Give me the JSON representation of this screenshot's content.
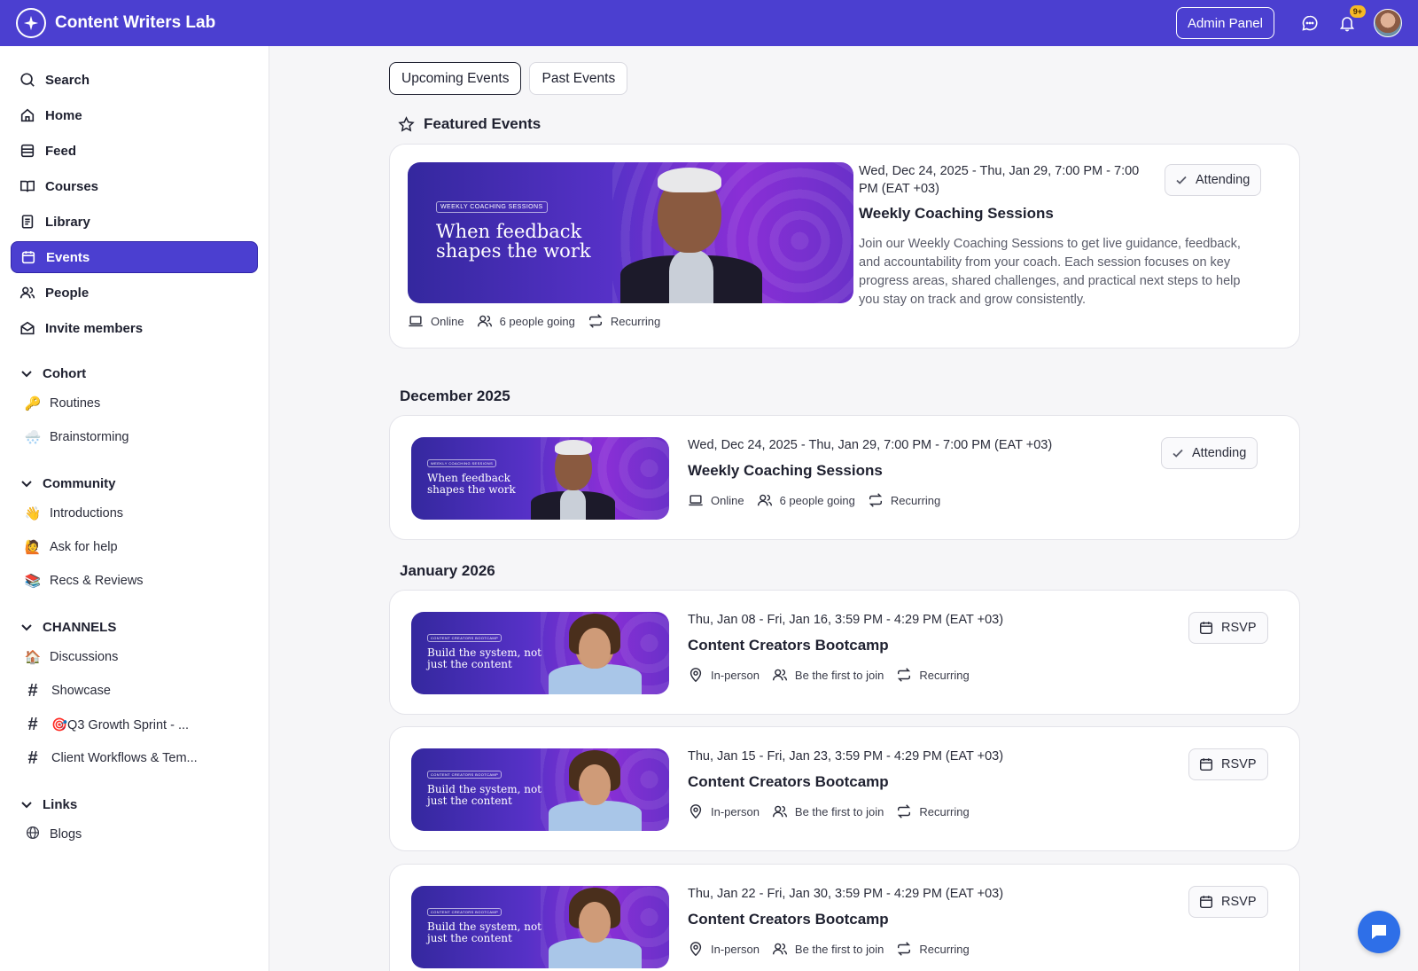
{
  "app": {
    "title": "Content Writers Lab"
  },
  "topbar": {
    "admin_label": "Admin Panel",
    "notif_badge": "9+"
  },
  "sidebar": {
    "nav": [
      {
        "label": "Search",
        "icon": "search-icon"
      },
      {
        "label": "Home",
        "icon": "home-icon"
      },
      {
        "label": "Feed",
        "icon": "feed-icon"
      },
      {
        "label": "Courses",
        "icon": "book-icon"
      },
      {
        "label": "Library",
        "icon": "library-icon"
      },
      {
        "label": "Events",
        "icon": "calendar-icon",
        "active": true
      },
      {
        "label": "People",
        "icon": "people-icon"
      },
      {
        "label": "Invite members",
        "icon": "envelope-icon"
      }
    ],
    "sections": {
      "cohort": {
        "label": "Cohort",
        "items": [
          {
            "emoji": "🔑",
            "label": "Routines"
          },
          {
            "emoji": "🌨️",
            "label": "Brainstorming"
          }
        ]
      },
      "community": {
        "label": "Community",
        "items": [
          {
            "emoji": "👋",
            "label": "Introductions"
          },
          {
            "emoji": "🙋",
            "label": "Ask for help"
          },
          {
            "emoji": "📚",
            "label": "Recs & Reviews"
          }
        ]
      },
      "channels": {
        "label": "CHANNELS",
        "items": [
          {
            "emoji": "🏠",
            "label": "Discussions"
          },
          {
            "emoji": "#",
            "label": "Showcase"
          },
          {
            "emoji": "#",
            "label": "🎯Q3 Growth Sprint - ..."
          },
          {
            "emoji": "#",
            "label": "Client Workflows & Tem..."
          }
        ]
      },
      "links": {
        "label": "Links",
        "items": [
          {
            "emoji": "globe",
            "label": "Blogs"
          }
        ]
      }
    }
  },
  "tabs": {
    "upcoming": "Upcoming Events",
    "past": "Past Events"
  },
  "featured": {
    "heading": "Featured Events",
    "date": "Wed, Dec 24, 2025 - Thu, Jan 29, 7:00 PM - 7:00 PM (EAT +03)",
    "title": "Weekly Coaching Sessions",
    "description": "Join our Weekly Coaching Sessions to get live guidance, feedback, and accountability from your coach. Each session focuses on key progress areas, shared challenges, and practical next steps to help you stay on track and grow consistently.",
    "status": "Attending",
    "banner": {
      "tag": "WEEKLY COACHING SESSIONS",
      "headline_1": "When feedback",
      "headline_2": "shapes the work"
    },
    "meta": {
      "location": "Online",
      "going": "6 people going",
      "recurrence": "Recurring"
    }
  },
  "months": {
    "dec": "December 2025",
    "jan": "January 2026"
  },
  "events": [
    {
      "date": "Wed, Dec 24, 2025 - Thu, Jan 29, 7:00 PM - 7:00 PM (EAT +03)",
      "title": "Weekly Coaching Sessions",
      "status": "Attending",
      "banner": {
        "tag": "WEEKLY COACHING SESSIONS",
        "headline_1": "When feedback",
        "headline_2": "shapes the work"
      },
      "meta": {
        "location": "Online",
        "going": "6 people going",
        "recurrence": "Recurring"
      }
    },
    {
      "date": "Thu, Jan 08 - Fri, Jan 16, 3:59 PM - 4:29 PM (EAT +03)",
      "title": "Content Creators Bootcamp",
      "status": "RSVP",
      "banner": {
        "tag": "CONTENT CREATORS BOOTCAMP",
        "headline_1": "Build the system, not",
        "headline_2": "just the content"
      },
      "meta": {
        "location": "In-person",
        "going": "Be the first to join",
        "recurrence": "Recurring"
      }
    },
    {
      "date": "Thu, Jan 15 - Fri, Jan 23, 3:59 PM - 4:29 PM (EAT +03)",
      "title": "Content Creators Bootcamp",
      "status": "RSVP",
      "banner": {
        "tag": "CONTENT CREATORS BOOTCAMP",
        "headline_1": "Build the system, not",
        "headline_2": "just the content"
      },
      "meta": {
        "location": "In-person",
        "going": "Be the first to join",
        "recurrence": "Recurring"
      }
    },
    {
      "date": "Thu, Jan 22 - Fri, Jan 30, 3:59 PM - 4:29 PM (EAT +03)",
      "title": "Content Creators Bootcamp",
      "status": "RSVP",
      "banner": {
        "tag": "CONTENT CREATORS BOOTCAMP",
        "headline_1": "Build the system, not",
        "headline_2": "just the content"
      },
      "meta": {
        "location": "In-person",
        "going": "Be the first to join",
        "recurrence": "Recurring"
      }
    }
  ],
  "colors": {
    "brand": "#4b3fd0",
    "accent_badge": "#f6b926",
    "chat": "#2e6fe8"
  }
}
